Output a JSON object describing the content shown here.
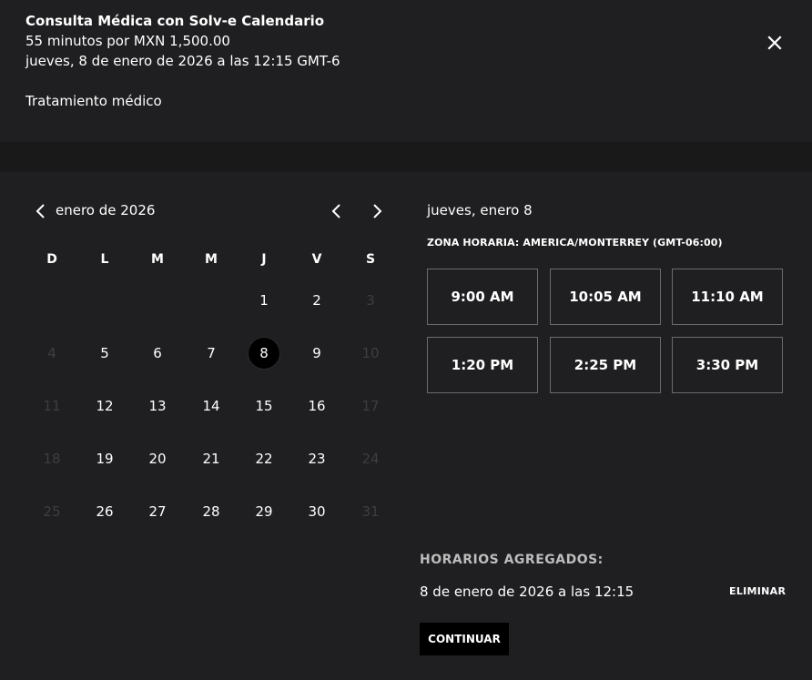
{
  "header": {
    "title": "Consulta Médica con Solv-e Calendario",
    "price_line": "55 minutos por MXN 1,500.00",
    "date_line": "jueves, 8 de enero de 2026 a las 12:15 GMT-6",
    "description": "Tratamiento médico",
    "close_icon": "close-icon"
  },
  "calendar": {
    "month_label": "enero de 2026",
    "weekdays": [
      "D",
      "L",
      "M",
      "M",
      "J",
      "V",
      "S"
    ],
    "weeks": [
      [
        null,
        null,
        null,
        null,
        {
          "day": "1",
          "available": true
        },
        {
          "day": "2",
          "available": true
        },
        {
          "day": "3",
          "available": false
        }
      ],
      [
        {
          "day": "4",
          "available": false
        },
        {
          "day": "5",
          "available": true
        },
        {
          "day": "6",
          "available": true
        },
        {
          "day": "7",
          "available": true
        },
        {
          "day": "8",
          "available": true,
          "selected": true
        },
        {
          "day": "9",
          "available": true
        },
        {
          "day": "10",
          "available": false
        }
      ],
      [
        {
          "day": "11",
          "available": false
        },
        {
          "day": "12",
          "available": true
        },
        {
          "day": "13",
          "available": true
        },
        {
          "day": "14",
          "available": true
        },
        {
          "day": "15",
          "available": true
        },
        {
          "day": "16",
          "available": true
        },
        {
          "day": "17",
          "available": false
        }
      ],
      [
        {
          "day": "18",
          "available": false
        },
        {
          "day": "19",
          "available": true
        },
        {
          "day": "20",
          "available": true
        },
        {
          "day": "21",
          "available": true
        },
        {
          "day": "22",
          "available": true
        },
        {
          "day": "23",
          "available": true
        },
        {
          "day": "24",
          "available": false
        }
      ],
      [
        {
          "day": "25",
          "available": false
        },
        {
          "day": "26",
          "available": true
        },
        {
          "day": "27",
          "available": true
        },
        {
          "day": "28",
          "available": true
        },
        {
          "day": "29",
          "available": true
        },
        {
          "day": "30",
          "available": true
        },
        {
          "day": "31",
          "available": false
        }
      ]
    ]
  },
  "schedule": {
    "selected_date": "jueves, enero 8",
    "timezone": "ZONA HORARIA: AMERICA/MONTERREY (GMT-06:00)",
    "slots": [
      "9:00 AM",
      "10:05 AM",
      "11:10 AM",
      "1:20 PM",
      "2:25 PM",
      "3:30 PM"
    ]
  },
  "added": {
    "label": "HORARIOS AGREGADOS:",
    "item": "8 de enero de 2026 a las 12:15",
    "remove_label": "ELIMINAR",
    "continue_label": "CONTINUAR"
  },
  "colors": {
    "background": "#1f1f21",
    "band": "#19191a",
    "disabled_day": "#3e3e41",
    "selected_day": "#000000",
    "slot_border": "#6b6b6e"
  }
}
